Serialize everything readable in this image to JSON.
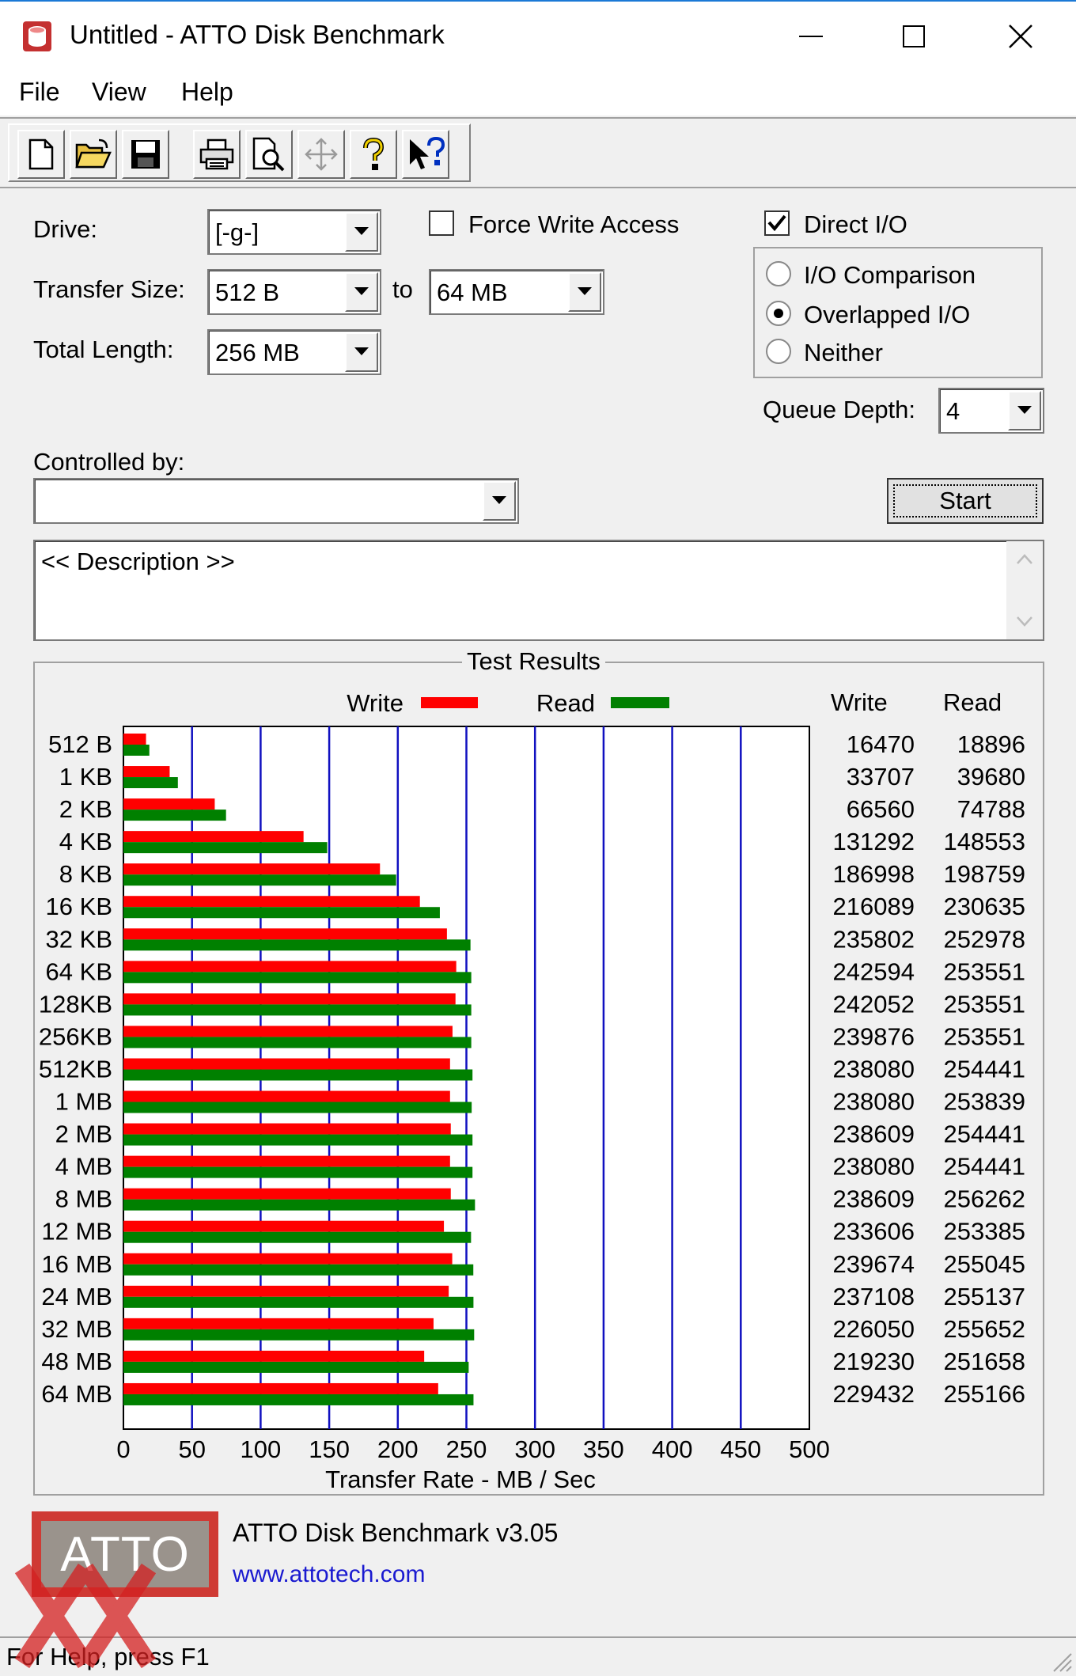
{
  "window": {
    "title": "Untitled - ATTO Disk Benchmark"
  },
  "menu": {
    "file": "File",
    "view": "View",
    "help": "Help"
  },
  "toolbar": {
    "icons": [
      "new-icon",
      "open-icon",
      "save-icon",
      "print-icon",
      "print-preview-icon",
      "move-icon",
      "help-icon",
      "context-help-icon"
    ]
  },
  "controls": {
    "drive_label": "Drive:",
    "drive_value": "[-g-]",
    "force_write_label": "Force Write Access",
    "force_write_checked": false,
    "direct_io_label": "Direct I/O",
    "direct_io_checked": true,
    "transfer_label": "Transfer Size:",
    "transfer_from": "512 B",
    "to_label": "to",
    "transfer_to": "64 MB",
    "total_length_label": "Total Length:",
    "total_length_value": "256 MB",
    "io_comparison_label": "I/O Comparison",
    "overlapped_label": "Overlapped I/O",
    "neither_label": "Neither",
    "selected_mode": "Overlapped I/O",
    "queue_depth_label": "Queue Depth:",
    "queue_depth_value": "4",
    "controlled_by_label": "Controlled by:",
    "controlled_by_value": "",
    "start_label": "Start",
    "description_text": "<< Description >>"
  },
  "results": {
    "title": "Test Results",
    "write_col": "Write",
    "read_col": "Read"
  },
  "chart_data": {
    "type": "bar",
    "orientation": "horizontal",
    "xlabel": "Transfer Rate - MB / Sec",
    "xlim": [
      0,
      500
    ],
    "xticks": [
      0,
      50,
      100,
      150,
      200,
      250,
      300,
      350,
      400,
      450,
      500
    ],
    "grid": true,
    "legend_placement": "top",
    "categories": [
      "512 B",
      "1 KB",
      "2 KB",
      "4 KB",
      "8 KB",
      "16 KB",
      "32 KB",
      "64 KB",
      "128KB",
      "256KB",
      "512KB",
      "1 MB",
      "2 MB",
      "4 MB",
      "8 MB",
      "12 MB",
      "16 MB",
      "24 MB",
      "32 MB",
      "48 MB",
      "64 MB"
    ],
    "series": [
      {
        "name": "Write",
        "color": "#ff0000",
        "values": [
          16470,
          33707,
          66560,
          131292,
          186998,
          216089,
          235802,
          242594,
          242052,
          239876,
          238080,
          238080,
          238609,
          238080,
          238609,
          233606,
          239674,
          237108,
          226050,
          219230,
          229432
        ]
      },
      {
        "name": "Read",
        "color": "#008000",
        "values": [
          18896,
          39680,
          74788,
          148553,
          198759,
          230635,
          252978,
          253551,
          253551,
          253551,
          254441,
          253839,
          254441,
          254441,
          256262,
          253385,
          255045,
          255137,
          255652,
          251658,
          255166
        ]
      }
    ]
  },
  "footer": {
    "logo_text": "ATTO",
    "version": "ATTO Disk Benchmark v3.05",
    "website": "www.attotech.com",
    "status": "For Help, press F1"
  },
  "colors": {
    "grid": "#1010c0",
    "write": "#ff0000",
    "read": "#008000",
    "link": "#1a1ad0"
  }
}
